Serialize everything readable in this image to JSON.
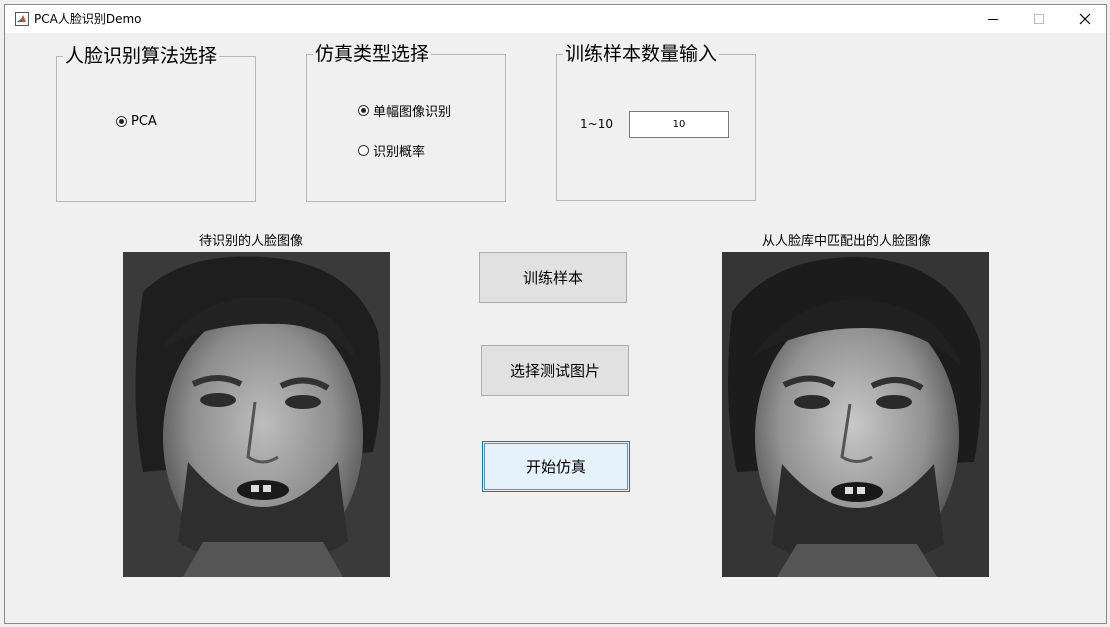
{
  "window": {
    "title": "PCA人脸识别Demo",
    "icons": [
      "matlab-icon",
      "minimize-icon",
      "maximize-icon",
      "close-icon"
    ]
  },
  "algorithm_group": {
    "title": "人脸识别算法选择",
    "options": [
      {
        "label": "PCA",
        "checked": true
      }
    ]
  },
  "simulation_group": {
    "title": "仿真类型选择",
    "options": [
      {
        "label": "单幅图像识别",
        "checked": true
      },
      {
        "label": "识别概率",
        "checked": false
      }
    ]
  },
  "training_group": {
    "title": "训练样本数量输入",
    "range_label": "1~10",
    "input_value": "10"
  },
  "images": {
    "test_caption": "待识别的人脸图像",
    "match_caption": "从人脸库中匹配出的人脸图像"
  },
  "buttons": {
    "train": "训练样本",
    "select_test": "选择测试图片",
    "start": "开始仿真"
  },
  "colors": {
    "window_bg": "#f0f0f0",
    "focused_button_bg": "#e5f1fb",
    "focused_button_border": "#0078d7"
  }
}
